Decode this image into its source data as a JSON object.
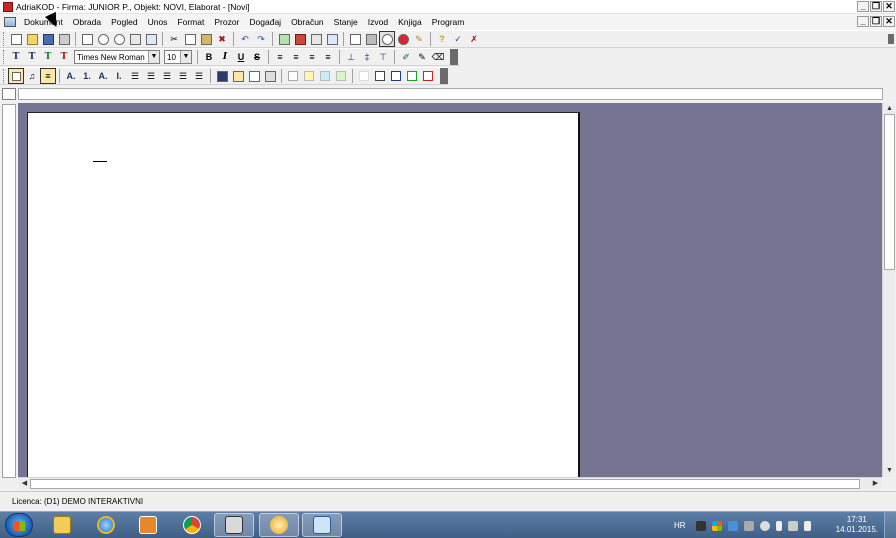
{
  "window": {
    "title": "AdriaKOD - Firma: JUNIOR P.,  Objekt: NOVI, Elaborat - [Novi]",
    "controls": {
      "minimize": "_",
      "restore": "❐",
      "close": "✕"
    }
  },
  "menubar": {
    "items": [
      {
        "label": "Dokument"
      },
      {
        "label": "Obrada"
      },
      {
        "label": "Pogled"
      },
      {
        "label": "Unos"
      },
      {
        "label": "Format"
      },
      {
        "label": "Prozor"
      },
      {
        "label": "Događaj"
      },
      {
        "label": "Obračun"
      },
      {
        "label": "Stanje"
      },
      {
        "label": "Izvod"
      },
      {
        "label": "Knjiga"
      },
      {
        "label": "Program"
      }
    ]
  },
  "format_toolbar": {
    "text_buttons": [
      "T",
      "T",
      "T",
      "T"
    ],
    "font": "Times New Roman",
    "size": "10",
    "bold": "B",
    "italic": "I",
    "underline": "U",
    "strike": "S"
  },
  "list_toolbar": {
    "letters": [
      "A.",
      "1.",
      "A.",
      "I."
    ]
  },
  "statusbar": {
    "text": "Licenca:  (D1) DEMO INTERAKTIVNI"
  },
  "taskbar": {
    "language": "HR",
    "time": "17:31",
    "date": "14.01.2015."
  },
  "colors": {
    "workspace": "#767493",
    "taskbar": "#4a6b93"
  }
}
